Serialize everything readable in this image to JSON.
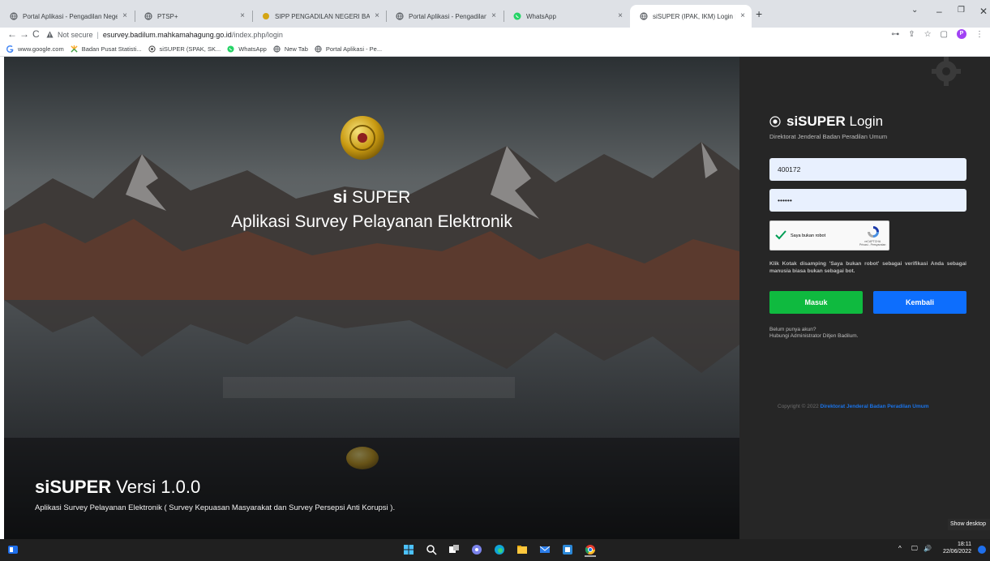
{
  "browser": {
    "tabs": [
      {
        "title": "Portal Aplikasi - Pengadilan Nege",
        "icon": "globe-icon"
      },
      {
        "title": "PTSP+",
        "icon": "globe-icon"
      },
      {
        "title": "SIPP PENGADILAN NEGERI BANT",
        "icon": "emblem-icon"
      },
      {
        "title": "Portal Aplikasi - Pengadilan Nege",
        "icon": "globe-icon"
      },
      {
        "title": "WhatsApp",
        "icon": "whatsapp-icon"
      },
      {
        "title": "siSUPER (IPAK, IKM) Login | Direk",
        "icon": "globe-icon",
        "active": true
      }
    ],
    "address": {
      "security_label": "Not secure",
      "host": "esurvey.badilum.mahkamahagung.go.id",
      "path": "/index.php/login"
    },
    "profile_initial": "P",
    "bookmarks": [
      {
        "label": "www.google.com",
        "icon": "google-icon"
      },
      {
        "label": "Badan Pusat Statisti...",
        "icon": "bps-icon"
      },
      {
        "label": "siSUPER (SPAK, SK...",
        "icon": "sisuper-icon"
      },
      {
        "label": "WhatsApp",
        "icon": "whatsapp-icon"
      },
      {
        "label": "New Tab",
        "icon": "globe-icon"
      },
      {
        "label": "Portal Aplikasi - Pe...",
        "icon": "globe-icon"
      }
    ]
  },
  "hero": {
    "brand_prefix": "si",
    "brand_name": "SUPER",
    "tagline": "Aplikasi Survey Pelayanan Elektronik",
    "version_prefix": "siSUPER",
    "version_label": "Versi 1.0.0",
    "description": "Aplikasi Survey Pelayanan Elektronik ( Survey Kepuasan Masyarakat dan Survey Persepsi Anti Korupsi )."
  },
  "login": {
    "title_bold": "siSUPER",
    "title_rest": "Login",
    "subtitle": "Direktorat Jenderal Badan Peradilan Umum",
    "username_value": "400172",
    "password_value": "••••••",
    "captcha_label": "Saya bukan robot",
    "captcha_brand": "reCAPTCHA",
    "captcha_links": "Privasi - Persyaratan",
    "hint": "Klik Kotak disamping 'Saya bukan robot' sebagai verifikasi Anda sebagai manusia biasa bukan sebagai bot.",
    "submit_label": "Masuk",
    "back_label": "Kembali",
    "no_account": "Belum punya akun?",
    "contact": "Hubungi Administrator Ditjen Badilum.",
    "copyright_prefix": "Copyright © 2022",
    "copyright_org": "Direktorat Jenderal Badan Peradilan Umum",
    "colors": {
      "submit": "#0fba3f",
      "back": "#0d6efd",
      "panel": "#262626"
    }
  },
  "system": {
    "show_desktop": "Show desktop",
    "time": "18:11",
    "date": "22/06/2022"
  }
}
